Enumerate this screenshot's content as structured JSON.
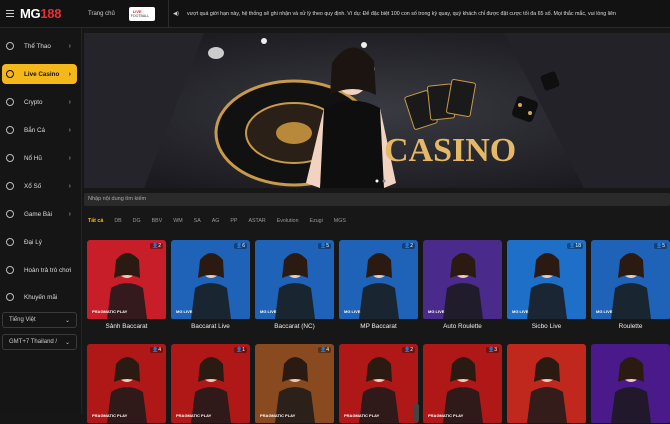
{
  "header": {
    "logo": {
      "prefix": "MG",
      "suffix": "188"
    },
    "nav_home": "Trang chủ",
    "live_badge_top": "LIVE",
    "live_badge_bottom": "FOOTBALL",
    "ticker": "vượt quá giới hạn này, hệ thống sẽ ghi nhận và xử lý theo quy định. Ví dụ: Để đặc biệt 100 con số trong kỳ quay, quý khách chỉ được đặt cược tối đa 65 số. Mọi thắc mắc, vui lòng liên"
  },
  "sidebar": {
    "items": [
      {
        "label": "Thể Thao",
        "icon": "soccer-ball-icon"
      },
      {
        "label": "Live Casino",
        "icon": "live-casino-icon"
      },
      {
        "label": "Crypto",
        "icon": "crypto-icon"
      },
      {
        "label": "Bắn Cá",
        "icon": "fish-icon"
      },
      {
        "label": "Nổ Hũ",
        "icon": "slot-icon"
      },
      {
        "label": "Xổ Số",
        "icon": "lottery-icon"
      },
      {
        "label": "Game Bài",
        "icon": "cards-icon"
      },
      {
        "label": "Đại Lý",
        "icon": "agent-icon"
      },
      {
        "label": "Hoàn trả trò chơi",
        "icon": "refund-icon"
      },
      {
        "label": "Khuyến mãi",
        "icon": "gift-icon"
      }
    ],
    "language": "Tiếng Việt",
    "timezone": "GMT+7 Thailand /"
  },
  "search": {
    "placeholder": "Nhập nội dung tìm kiếm"
  },
  "providers": [
    "Tất cả",
    "DB",
    "DG",
    "BBV",
    "WM",
    "SA",
    "AG",
    "PP",
    "ASTAR",
    "Evolution",
    "Ezugi",
    "MGS"
  ],
  "banner_text": "CASINO",
  "games_row1": [
    {
      "name": "Sảnh Baccarat",
      "count": "2",
      "brand": "PRAGMATIC PLAY",
      "bg": "#c81e2a"
    },
    {
      "name": "Baccarat Live",
      "count": "6",
      "brand": "MG LIVE",
      "bg": "#1e63b8"
    },
    {
      "name": "Baccarat (NC)",
      "count": "5",
      "brand": "MG LIVE",
      "bg": "#1e63b8"
    },
    {
      "name": "MP Baccarat",
      "count": "2",
      "brand": "MG LIVE",
      "bg": "#1e63b8"
    },
    {
      "name": "Auto Roulette",
      "count": "",
      "brand": "MG LIVE",
      "bg": "#4a2a8a"
    },
    {
      "name": "Sicbo Live",
      "count": "18",
      "brand": "MG LIVE",
      "bg": "#1e6fc8"
    },
    {
      "name": "Roulette",
      "count": "5",
      "brand": "MG LIVE",
      "bg": "#1e63b8"
    }
  ],
  "games_row2": [
    {
      "count": "4",
      "brand": "PRAGMATIC PLAY",
      "bg": "#b01818"
    },
    {
      "count": "1",
      "brand": "PRAGMATIC PLAY",
      "bg": "#b01818"
    },
    {
      "count": "4",
      "brand": "PRAGMATIC PLAY",
      "bg": "#8a4a20"
    },
    {
      "count": "2",
      "brand": "PRAGMATIC PLAY",
      "bg": "#b01818"
    },
    {
      "count": "3",
      "brand": "PRAGMATIC PLAY",
      "bg": "#b01818"
    },
    {
      "count": "",
      "brand": "",
      "bg": "#c0281e"
    },
    {
      "count": "",
      "brand": "",
      "bg": "#4a1a8a"
    }
  ]
}
